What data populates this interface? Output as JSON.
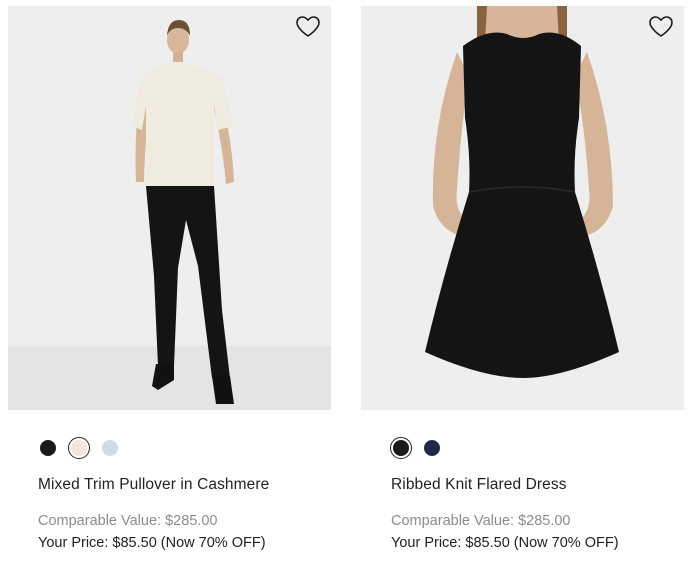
{
  "products": [
    {
      "name": "Mixed Trim Pullover in Cashmere",
      "swatches": [
        {
          "color": "#1a1a1a",
          "selected": false
        },
        {
          "color": "#efe9dc",
          "selected": true
        },
        {
          "color": "#ccdbe4",
          "selected": false
        }
      ],
      "comparable_value": "Comparable Value: $285.00",
      "your_price": "Your Price: $85.50 (Now 70% OFF)",
      "wishlist_icon": "heart-outline-icon"
    },
    {
      "name": "Ribbed Knit Flared Dress",
      "swatches": [
        {
          "color": "#1a1a1a",
          "selected": true
        },
        {
          "color": "#1f2a44",
          "selected": false
        }
      ],
      "comparable_value": "Comparable Value: $285.00",
      "your_price": "Your Price: $85.50 (Now 70% OFF)",
      "wishlist_icon": "heart-outline-icon"
    }
  ]
}
